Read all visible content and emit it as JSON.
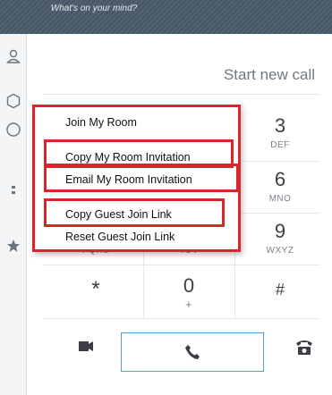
{
  "topbar": {
    "status_placeholder": "What's on your mind?"
  },
  "dialer": {
    "input_placeholder": "Start new call",
    "keys": [
      {
        "digit": "3",
        "letters": "DEF"
      },
      {
        "digit": "6",
        "letters": "MNO"
      },
      {
        "digit": "9",
        "letters": "WXYZ"
      },
      {
        "digit": "",
        "letters": "PQRS"
      },
      {
        "digit": "",
        "letters": "TUV"
      },
      {
        "digit": "*",
        "letters": ""
      },
      {
        "digit": "0",
        "letters": "+"
      },
      {
        "digit": "#",
        "letters": ""
      }
    ]
  },
  "context_menu": {
    "items": [
      {
        "label": "Join My Room"
      },
      {
        "label": "Copy My Room Invitation"
      },
      {
        "label": "Email My Room Invitation"
      },
      {
        "label": "Copy Guest Join Link"
      },
      {
        "label": "Reset Guest Join Link"
      }
    ]
  },
  "icons": {
    "sidebar": [
      "user-icon",
      "hexagon-icon",
      "clock-icon",
      "more-icon",
      "star-icon"
    ],
    "bottom": [
      "video-icon",
      "phone-icon",
      "desk-phone-icon"
    ]
  },
  "colors": {
    "accent": "#4b9fd5",
    "highlight": "#d9252b",
    "topbar": "#4a5a6b"
  }
}
